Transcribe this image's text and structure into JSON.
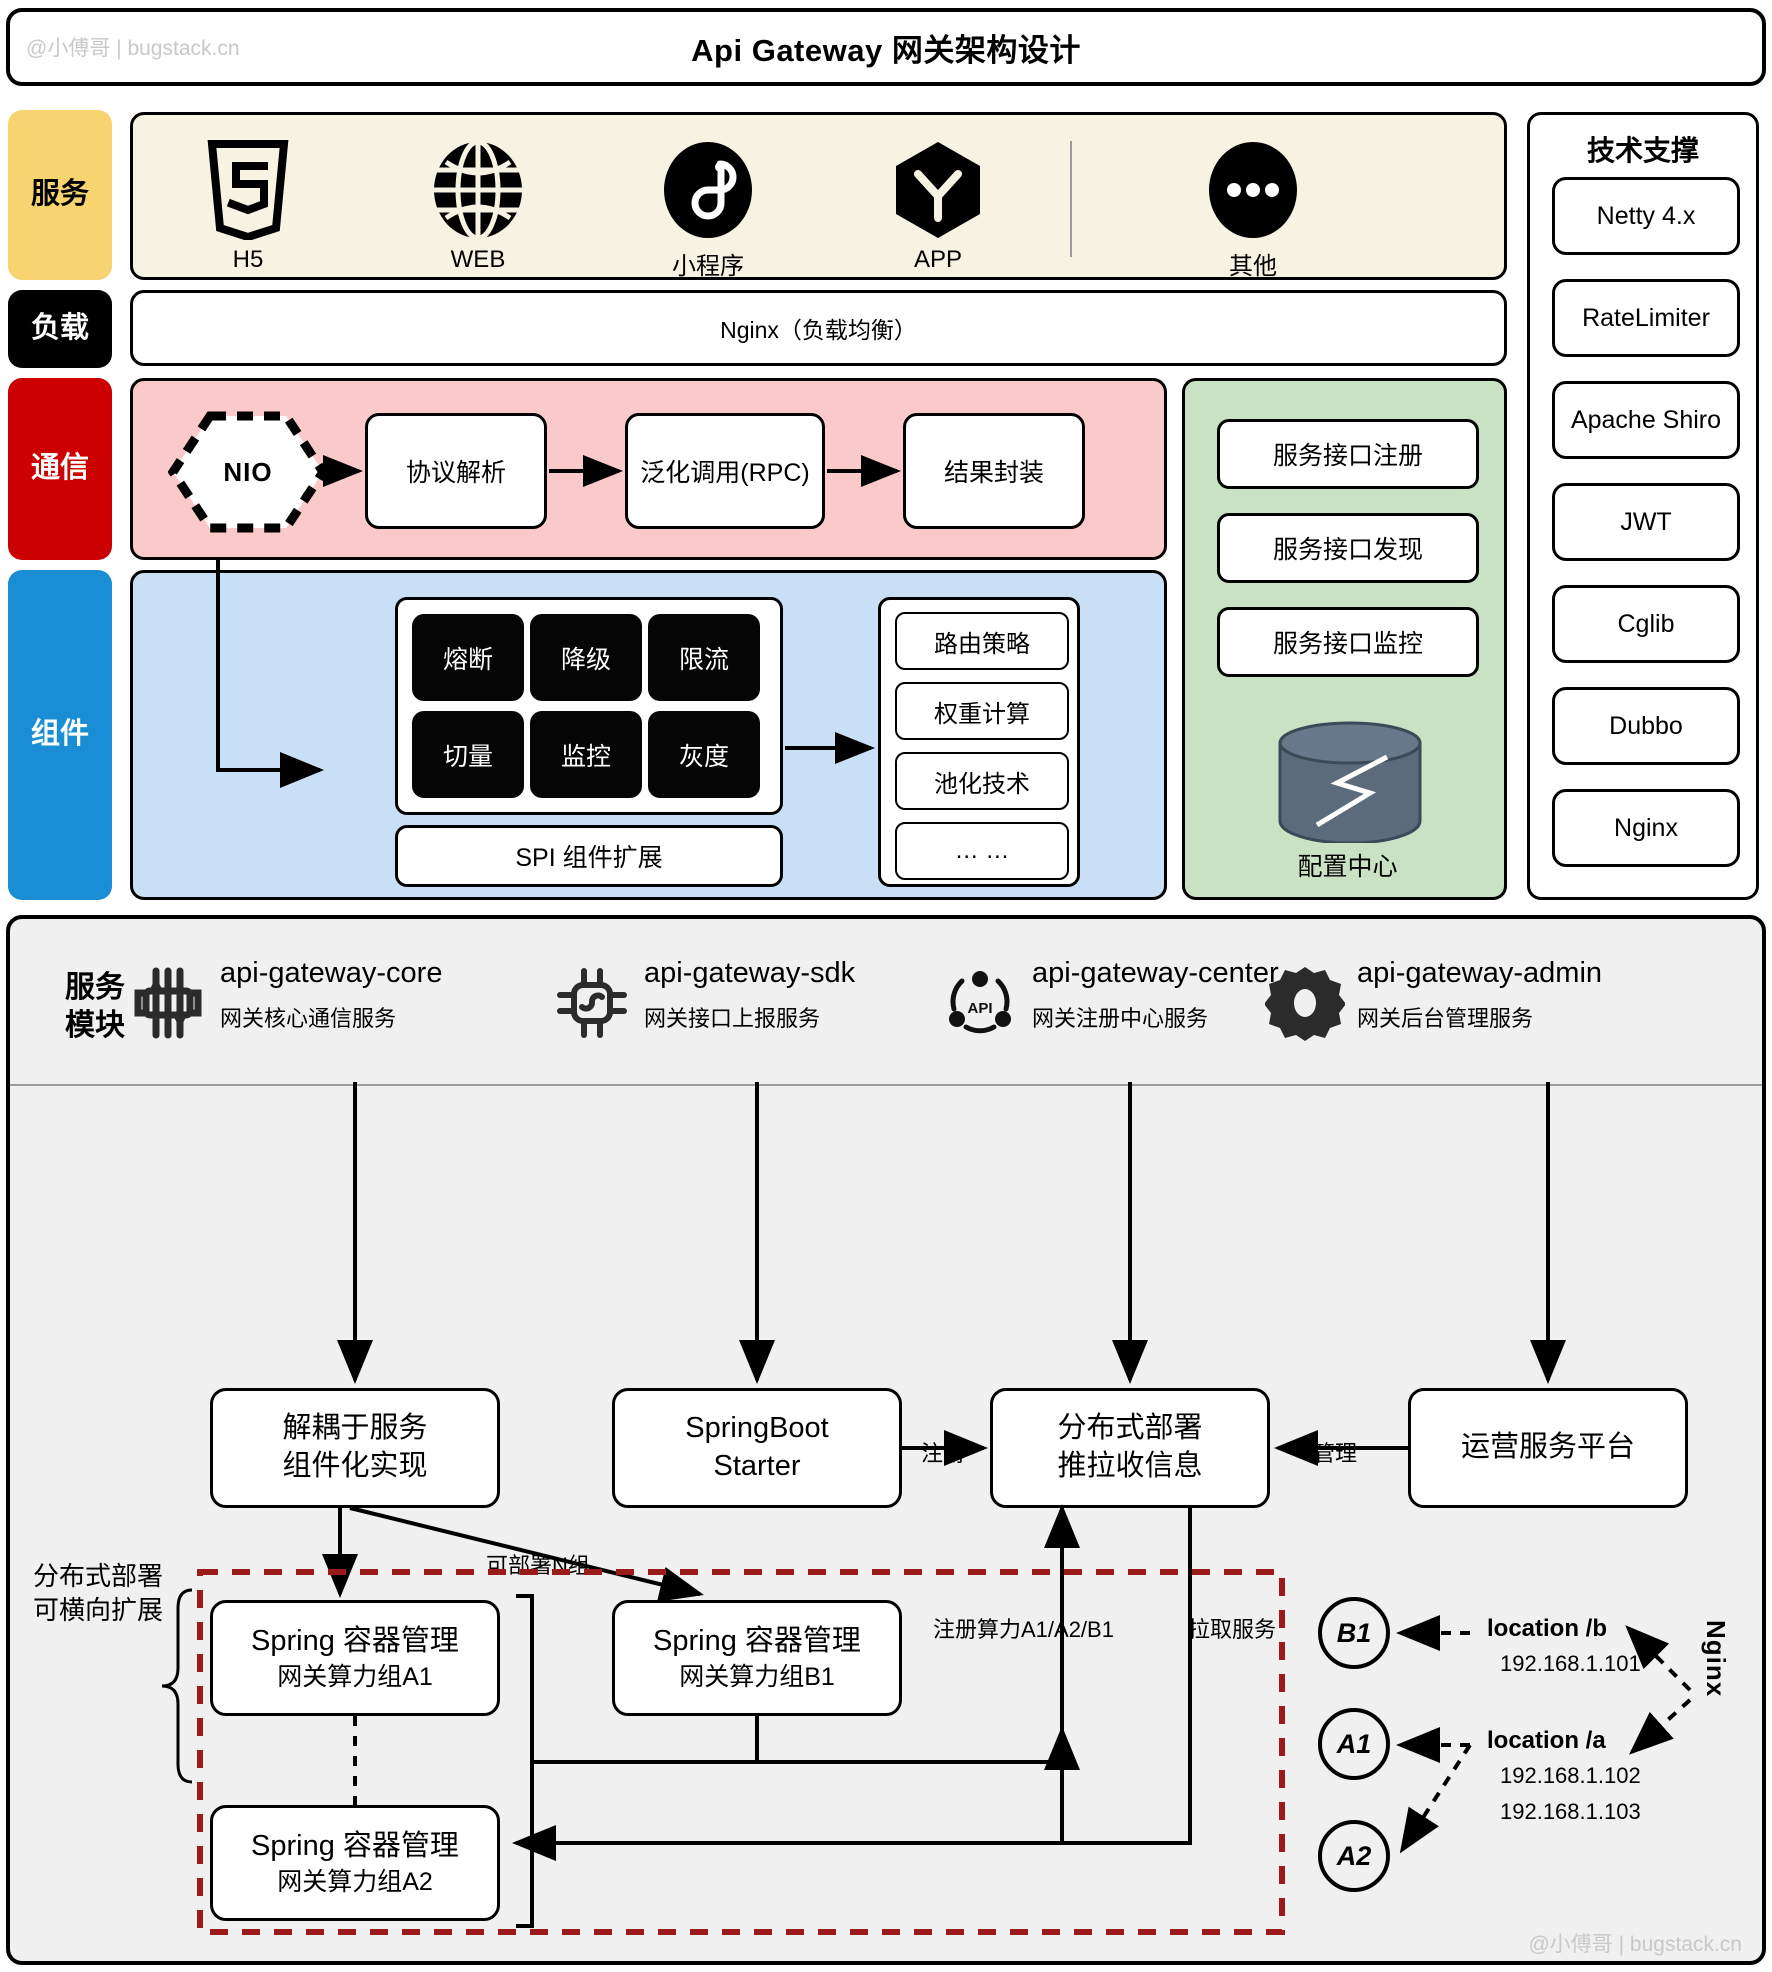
{
  "header": {
    "title": "Api Gateway 网关架构设计",
    "watermark": "@小傅哥 | bugstack.cn"
  },
  "layers": [
    {
      "name": "service",
      "label": "服务",
      "color": "#F8D471"
    },
    {
      "name": "load",
      "label": "负载",
      "color": "#000000"
    },
    {
      "name": "communication",
      "label": "通信",
      "color": "#CC0000"
    },
    {
      "name": "component",
      "label": "组件",
      "color": "#1A8ED4"
    }
  ],
  "service_band": {
    "background": "#F6F3E3",
    "items": [
      {
        "icon": "html5-icon",
        "label": "H5"
      },
      {
        "icon": "globe-icon",
        "label": "WEB"
      },
      {
        "icon": "mini-program-icon",
        "label": "小程序"
      },
      {
        "icon": "app-icon",
        "label": "APP"
      },
      {
        "icon": "ellipsis-icon",
        "label": "其他"
      }
    ]
  },
  "load_balancer": {
    "label": "Nginx（负载均衡）"
  },
  "communication": {
    "background": "#FAC9C9",
    "entry": "NIO",
    "steps": [
      "协议解析",
      "泛化调用(RPC)",
      "结果封装"
    ]
  },
  "components": {
    "background": "#C9DFF5",
    "tiles": [
      "熔断",
      "降级",
      "限流",
      "切量",
      "监控",
      "灰度"
    ],
    "spi": "SPI 组件扩展",
    "policies": [
      "路由策略",
      "权重计算",
      "池化技术",
      "… …"
    ]
  },
  "registry": {
    "background": "#C9E2C4",
    "items": [
      "服务接口注册",
      "服务接口发现",
      "服务接口监控"
    ],
    "database_label": "配置中心",
    "database_color": "#5B6B7C"
  },
  "tech_support": {
    "title": "技术支撑",
    "items": [
      "Netty 4.x",
      "RateLimiter",
      "Apache Shiro",
      "JWT",
      "Cglib",
      "Dubbo",
      "Nginx"
    ]
  },
  "modules": {
    "title": "服务\n模块",
    "title_line1": "服务",
    "title_line2": "模块",
    "items": [
      {
        "icon": "core-chip-icon",
        "name": "api-gateway-core",
        "desc": "网关核心通信服务"
      },
      {
        "icon": "sdk-chip-icon",
        "name": "api-gateway-sdk",
        "desc": "网关接口上报服务"
      },
      {
        "icon": "api-circle-icon",
        "name": "api-gateway-center",
        "desc": "网关注册中心服务"
      },
      {
        "icon": "gear-icon",
        "name": "api-gateway-admin",
        "desc": "网关后台管理服务"
      }
    ]
  },
  "deployment": {
    "boxes": [
      {
        "id": "core-box",
        "line1": "解耦于服务",
        "line2": "组件化实现"
      },
      {
        "id": "sdk-box",
        "line1": "SpringBoot",
        "line2": "Starter"
      },
      {
        "id": "center-box",
        "line1": "分布式部署",
        "line2": "推拉收信息"
      },
      {
        "id": "admin-box",
        "line1": "运营服务平台",
        "line2": ""
      }
    ],
    "groups": [
      {
        "id": "group-a1",
        "line1": "Spring 容器管理",
        "line2": "网关算力组A1"
      },
      {
        "id": "group-b1",
        "line1": "Spring 容器管理",
        "line2": "网关算力组B1"
      },
      {
        "id": "group-a2",
        "line1": "Spring 容器管理",
        "line2": "网关算力组A2"
      }
    ],
    "edge_labels": {
      "register": "注册",
      "manage": "管理",
      "deploy_n": "可部署N组",
      "register_power": "注册算力A1/A2/B1",
      "pull_service": "拉取服务"
    },
    "side_brace_label_line1": "分布式部署",
    "side_brace_label_line2": "可横向扩展",
    "dashed_group_color": "#9B1B1B"
  },
  "nginx_routing": {
    "nodes": [
      "B1",
      "A1",
      "A2"
    ],
    "routes": [
      {
        "location": "location /b",
        "ips": [
          "192.168.1.101"
        ]
      },
      {
        "location": "location /a",
        "ips": [
          "192.168.1.102",
          "192.168.1.103"
        ]
      }
    ],
    "label": "Nginx"
  }
}
